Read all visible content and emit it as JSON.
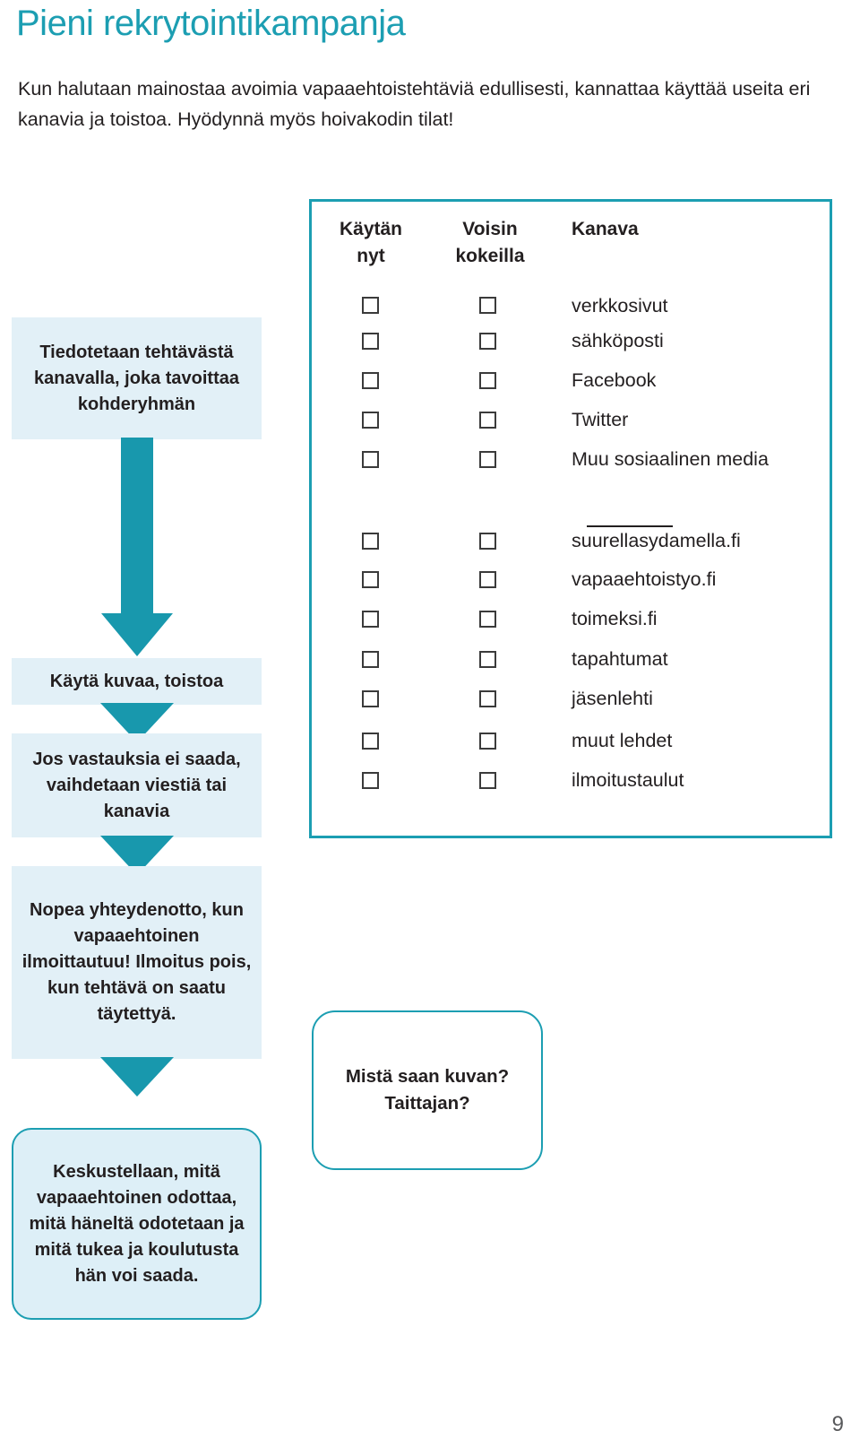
{
  "page": {
    "title": "Pieni rekrytointikampanja",
    "intro": "Kun halutaan mainostaa avoimia vapaaehtoistehtäviä edullisesti, kannattaa käyttää useita eri kanavia ja toistoa. Hyödynnä myös hoivakodin tilat!",
    "page_number": "9",
    "accent_color": "#1c9eb2",
    "box_fill_color": "#e2f0f7",
    "text_color": "#231f20"
  },
  "flow": {
    "steps": [
      {
        "text": "Tiedotetaan tehtävästä kanavalla, joka tavoittaa kohderyhmän",
        "style": "filled"
      },
      {
        "text": "Käytä kuvaa, toistoa",
        "style": "filled"
      },
      {
        "text": "Jos vastauksia ei saada, vaihdetaan viestiä tai kanavia",
        "style": "filled"
      },
      {
        "text": "Nopea yhteydenotto, kun vapaaehtoinen ilmoittautuu! Ilmoitus pois, kun tehtävä on saatu täytettyä.",
        "style": "filled"
      },
      {
        "text": "Keskustellaan, mitä vapaaehtoinen odottaa, mitä häneltä odotetaan ja mitä tukea ja koulutusta hän voi saada.",
        "style": "rounded"
      }
    ],
    "arrow_icon": "down-arrow-icon"
  },
  "checklist": {
    "headers": {
      "col1": "Käytän nyt",
      "col2": "Voisin kokeilla",
      "col3": "Kanava"
    },
    "group1": [
      {
        "label": "verkkosivut",
        "use_now": false,
        "could_try": false
      },
      {
        "label": "sähköposti",
        "use_now": false,
        "could_try": false
      },
      {
        "label": "Facebook",
        "use_now": false,
        "could_try": false
      },
      {
        "label": "Twitter",
        "use_now": false,
        "could_try": false
      },
      {
        "label": "Muu sosiaalinen media",
        "use_now": false,
        "could_try": false
      }
    ],
    "write_in": {
      "label": "",
      "is_blank_line": true
    },
    "group2": [
      {
        "label": "suurellasydamella.fi",
        "use_now": false,
        "could_try": false
      },
      {
        "label": "vapaaehtoistyo.fi",
        "use_now": false,
        "could_try": false
      },
      {
        "label": "toimeksi.fi",
        "use_now": false,
        "could_try": false
      },
      {
        "label": "tapahtumat",
        "use_now": false,
        "could_try": false
      },
      {
        "label": "jäsenlehti",
        "use_now": false,
        "could_try": false
      },
      {
        "label": "muut lehdet",
        "use_now": false,
        "could_try": false
      },
      {
        "label": "ilmoitustaulut",
        "use_now": false,
        "could_try": false
      }
    ]
  },
  "question_bubble": {
    "text": "Mistä saan kuvan? Taittajan?"
  }
}
